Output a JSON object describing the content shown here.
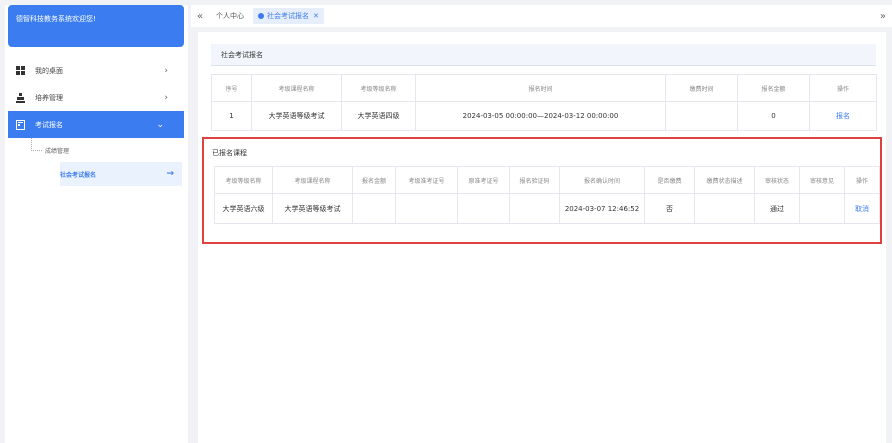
{
  "sidebar": {
    "brand": "德智科技教务系统欢迎您!",
    "items": [
      {
        "label": "我的桌面",
        "icon": "windows-icon"
      },
      {
        "label": "培养管理",
        "icon": "person-icon"
      },
      {
        "label": "考试报名",
        "icon": "form-icon"
      }
    ],
    "subitems": [
      {
        "label": "成绩管理"
      },
      {
        "label": "社会考试报名"
      }
    ]
  },
  "tabs": [
    {
      "label": "个人中心"
    },
    {
      "label": "社会考试报名"
    }
  ],
  "panel": {
    "title": "社会考试报名"
  },
  "exam_table": {
    "headers": [
      "序号",
      "考级课程名称",
      "考级等级名称",
      "报名时间",
      "缴费时间",
      "报名金额",
      "操作"
    ],
    "rows": [
      [
        "1",
        "大学英语等级考试",
        "大学英语四级",
        "2024-03-05 00:00:00—2024-03-12 00:00:00",
        "",
        "0",
        "报名"
      ]
    ]
  },
  "registered": {
    "title": "已报名课程",
    "headers": [
      "考级等级名称",
      "考级课程名称",
      "报名金额",
      "考级准考证号",
      "原准考证号",
      "报名验证码",
      "报名确认时间",
      "是否缴费",
      "缴费状态描述",
      "审核状态",
      "审核意见",
      "操作"
    ],
    "rows": [
      [
        "大学英语六级",
        "大学英语等级考试",
        "",
        "",
        "",
        "",
        "2024-03-07 12:46:52",
        "否",
        "",
        "通过",
        "",
        "取消"
      ]
    ]
  },
  "colors": {
    "accent": "#3b7df0",
    "highlight_border": "#e04040"
  }
}
